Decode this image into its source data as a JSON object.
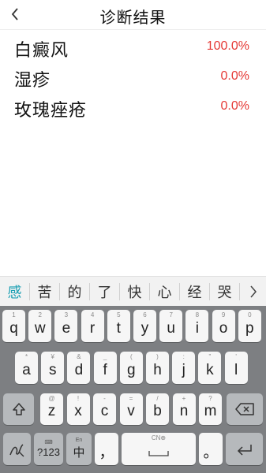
{
  "header": {
    "title": "诊断结果",
    "back_icon": "chevron-left-icon"
  },
  "results": [
    {
      "name": "白癜风",
      "value": "100.0%"
    },
    {
      "name": "湿疹",
      "value": "0.0%"
    },
    {
      "name": "玫瑰痤疮",
      "value": "0.0%"
    }
  ],
  "candidates": [
    "感",
    "苦",
    "的",
    "了",
    "快",
    "心",
    "经",
    "哭"
  ],
  "keyboard": {
    "row1": [
      {
        "k": "q",
        "s": "1"
      },
      {
        "k": "w",
        "s": "2"
      },
      {
        "k": "e",
        "s": "3"
      },
      {
        "k": "r",
        "s": "4"
      },
      {
        "k": "t",
        "s": "5"
      },
      {
        "k": "y",
        "s": "6"
      },
      {
        "k": "u",
        "s": "7"
      },
      {
        "k": "i",
        "s": "8"
      },
      {
        "k": "o",
        "s": "9"
      },
      {
        "k": "p",
        "s": "0"
      }
    ],
    "row2": [
      {
        "k": "a",
        "s": "*"
      },
      {
        "k": "s",
        "s": "¥"
      },
      {
        "k": "d",
        "s": "&"
      },
      {
        "k": "f",
        "s": "_"
      },
      {
        "k": "g",
        "s": "("
      },
      {
        "k": "h",
        "s": ")"
      },
      {
        "k": "j",
        "s": ":"
      },
      {
        "k": "k",
        "s": "\""
      },
      {
        "k": "l",
        "s": "'"
      }
    ],
    "row3": [
      {
        "k": "z",
        "s": "@"
      },
      {
        "k": "x",
        "s": "!"
      },
      {
        "k": "c",
        "s": "-"
      },
      {
        "k": "v",
        "s": "="
      },
      {
        "k": "b",
        "s": "/"
      },
      {
        "k": "n",
        "s": "+"
      },
      {
        "k": "m",
        "s": "?"
      }
    ],
    "num_label": "?123",
    "num_sub": "⌨",
    "lang_label": "中",
    "lang_sub": "En",
    "comma": "，",
    "space_sub": "CN⊕",
    "period": "。"
  },
  "accent_color": "#1ea0b4",
  "value_color": "#e53935"
}
